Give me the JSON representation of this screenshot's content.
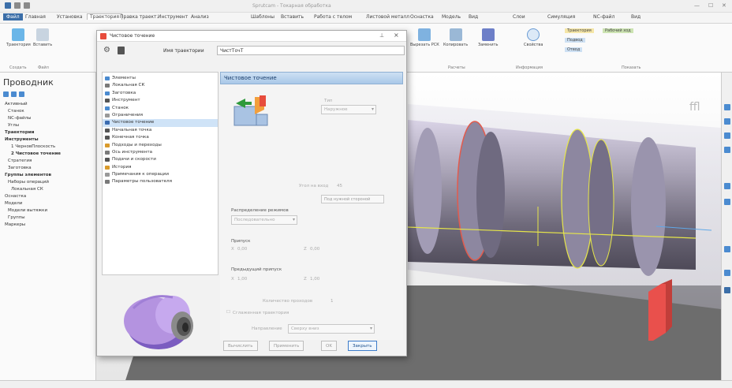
{
  "window": {
    "title": "Sprutcam - Токарная обработка",
    "ribbon_tabs": [
      "Файл",
      "Главная",
      "Установка",
      "Траектория",
      "Правка траект.",
      "Инструмент",
      "Анализ",
      "Шаблоны",
      "Вставить",
      "Работа с телом",
      "Листовой металл",
      "Оснастка",
      "Модель",
      "Вид",
      "Слои",
      "Симуляция",
      "NC-файл",
      "Вид"
    ]
  },
  "ribbon": {
    "buttons": [
      {
        "label": "Траектория",
        "icon": "toolpath-icon"
      },
      {
        "label": "Вставить",
        "icon": "insert-icon"
      },
      {
        "label": "Вырезать РСК",
        "icon": "cut-icon"
      },
      {
        "label": "Копировать",
        "icon": "copy-icon"
      },
      {
        "label": "Заменить",
        "icon": "replace-icon"
      },
      {
        "label": "Свойства",
        "icon": "info-icon"
      }
    ],
    "group_labels": [
      "Создать",
      "Файл",
      "Расчеты",
      "Информация",
      "Показать"
    ],
    "show_items": [
      "Траектория",
      "Рабочий ход",
      "Подвод",
      "Отвод"
    ]
  },
  "explorer": {
    "title": "Проводник",
    "items": [
      {
        "label": "Активный",
        "bold": false
      },
      {
        "label": "Станок",
        "bold": false
      },
      {
        "label": "NC-файлы",
        "bold": false
      },
      {
        "label": "Углы",
        "bold": false
      },
      {
        "label": "Траектории",
        "bold": true
      },
      {
        "label": "Инструменты",
        "bold": true
      },
      {
        "label": "1 ЧерновПлоскость",
        "bold": false
      },
      {
        "label": "2 Чистовое точение",
        "bold": true
      },
      {
        "label": "Стратегия",
        "bold": false
      },
      {
        "label": "Заготовка",
        "bold": false
      },
      {
        "label": "Группы элементов",
        "bold": true
      },
      {
        "label": "Наборы операций",
        "bold": false
      },
      {
        "label": "Локальная СК",
        "bold": false
      },
      {
        "label": "Оснастка",
        "bold": false
      },
      {
        "label": "Модели",
        "bold": false
      },
      {
        "label": "Модели вытяжки",
        "bold": false
      },
      {
        "label": "Группы",
        "bold": false
      },
      {
        "label": "Маркеры",
        "bold": false
      }
    ]
  },
  "dialog": {
    "title": "Чистовое точение",
    "name_label": "Имя траектории",
    "name_value": "ЧистТочТ",
    "tree": [
      {
        "label": "Элементы",
        "color": "#4b8bd0"
      },
      {
        "label": "Локальная СК",
        "color": "#7a7a7a"
      },
      {
        "label": "Заготовка",
        "color": "#4b8bd0"
      },
      {
        "label": "Инструмент",
        "color": "#555555"
      },
      {
        "label": "Станок",
        "color": "#4b8bd0"
      },
      {
        "label": "Ограничения",
        "color": "#999999"
      },
      {
        "label": "Чистовое точение",
        "color": "#3a6bb0"
      },
      {
        "label": "Начальная точка",
        "color": "#555555"
      },
      {
        "label": "Конечная точка",
        "color": "#555555"
      },
      {
        "label": "Подходы и переходы",
        "color": "#d99a2b"
      },
      {
        "label": "Ось инструмента",
        "color": "#7a7a7a"
      },
      {
        "label": "Подачи и скорости",
        "color": "#555555"
      },
      {
        "label": "История",
        "color": "#d99a2b"
      },
      {
        "label": "Примечания к операции",
        "color": "#999999"
      },
      {
        "label": "Параметры пользователя",
        "color": "#7a7a7a"
      }
    ],
    "panel_title": "Чистовое точение",
    "type_label": "Тип",
    "type_value": "Наружное",
    "angle_label": "Угол на вход",
    "angle_value": "45",
    "side_button": "Под нужной стороной",
    "cut_mode_label": "Распределение режимов",
    "cut_mode_value": "Последовательно",
    "step_label": "Припуск",
    "step_x_label": "X",
    "step_x_value": "0,00",
    "step_z_label": "Z",
    "step_z_value": "0,00",
    "prev_label": "Предыдущий припуск",
    "prev_x_label": "X",
    "prev_x_value": "1,00",
    "prev_z_label": "Z",
    "prev_z_value": "1,00",
    "passes_label": "Количество проходов",
    "passes_value": "1",
    "smooth_label": "Сглаженная траектория",
    "direction_label": "Направление",
    "direction_value": "Сверху вниз",
    "buttons": {
      "calc": "Вычислить",
      "apply": "Применить",
      "ok": "OK",
      "close": "Закрыть"
    }
  },
  "colors": {
    "accent": "#3b6ea8",
    "selection": "#cfe3f7",
    "part_purple": "#b493e0",
    "red_arrow": "#e9504c",
    "yellow_path": "#e6e64a"
  }
}
